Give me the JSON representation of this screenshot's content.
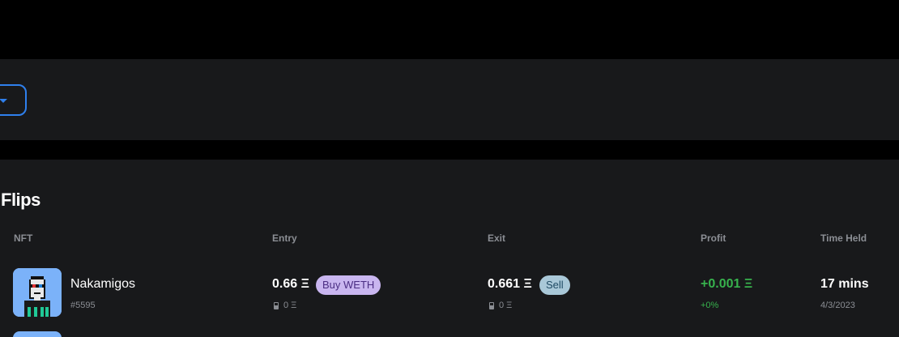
{
  "flips": {
    "title": "Flips",
    "columns": {
      "nft": "NFT",
      "entry": "Entry",
      "exit": "Exit",
      "profit": "Profit",
      "time_held": "Time Held"
    },
    "rows": [
      {
        "name": "Nakamigos",
        "token_id": "#5595",
        "entry_price": "0.66 Ξ",
        "entry_badge": "Buy WETH",
        "entry_gas": "0 Ξ",
        "exit_price": "0.661 Ξ",
        "exit_badge": "Sell",
        "exit_gas": "0 Ξ",
        "profit": "+0.001 Ξ",
        "profit_pct": "+0%",
        "time_held": "17 mins",
        "date": "4/3/2023"
      }
    ]
  },
  "colors": {
    "accent": "#2f80ed",
    "profit": "#37b24d",
    "panel": "#18191b",
    "buy_badge": "#c9b6f0",
    "sell_badge": "#a9c8d8",
    "avatar_bg": "#7bb2f9"
  },
  "icons": {
    "dropdown": "caret-down-icon",
    "gas": "gas-pump-icon"
  }
}
